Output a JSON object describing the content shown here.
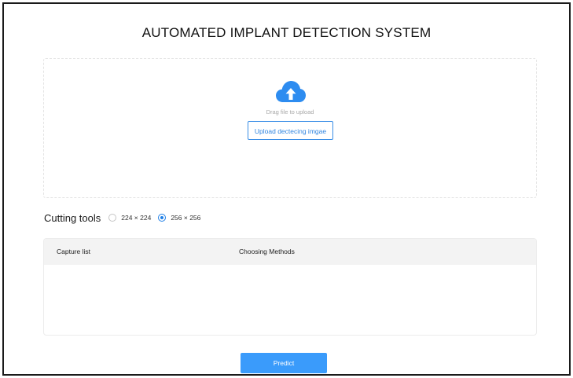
{
  "header": {
    "title": "AUTOMATED IMPLANT DETECTION SYSTEM"
  },
  "upload": {
    "icon": "cloud-upload-icon",
    "drag_text": "Drag file to upload",
    "button_label": "Upload dectecing imgae",
    "accent_color": "#3a8ee6"
  },
  "cutting_tools": {
    "label": "Cutting tools",
    "options": [
      {
        "label": "224 × 224",
        "selected": false
      },
      {
        "label": "256 × 256",
        "selected": true
      }
    ]
  },
  "table": {
    "columns": [
      "Capture list",
      "Choosing Methods"
    ],
    "rows": []
  },
  "actions": {
    "predict_label": "Predict",
    "predict_color": "#3a9bfb"
  }
}
